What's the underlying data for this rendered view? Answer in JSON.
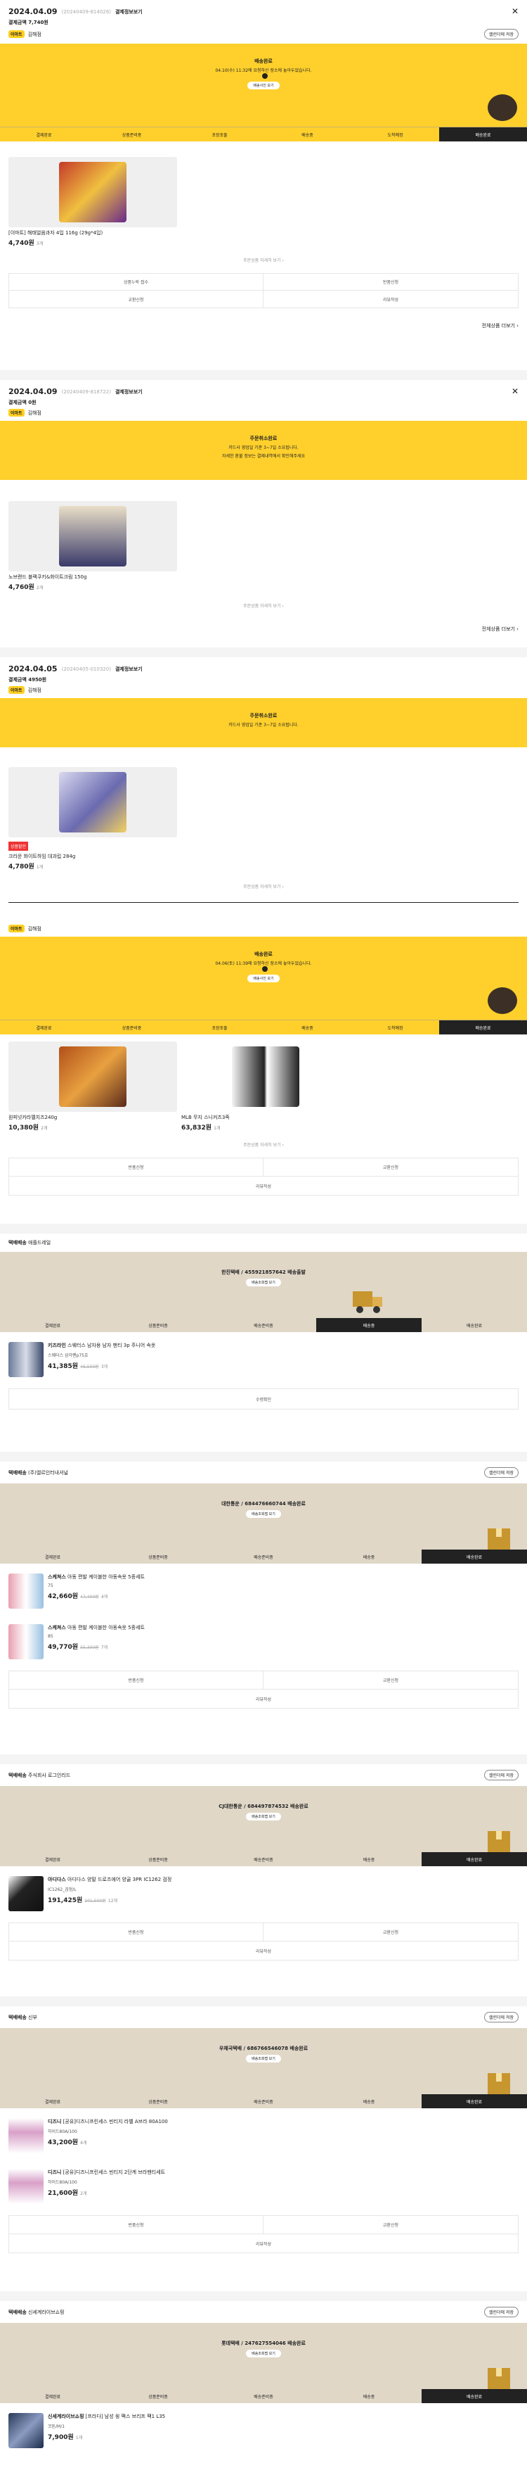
{
  "orders": [
    {
      "date": "2024.04.09",
      "order_no": "(20240409-814028)",
      "detail": "결제정보보기",
      "summary": "결제금액 7,740원",
      "shop": "김해점",
      "banner": {
        "title": "배송완료",
        "sub": "04.10(수) 11:32에 요청하신 장소에 놓아두었습니다.",
        "btn": "배송사진 보기"
      },
      "tabs": [
        "결제완료",
        "상품준비중",
        "포장포출",
        "배송중",
        "도착예정",
        "배송완료"
      ],
      "items": [
        {
          "name": "[이마트] 해태얼음과자 4입 116g (29g*4입)",
          "price": "4,740원",
          "qty": "3개"
        }
      ],
      "hint": "주문상품 자세히 보기 ›",
      "actions": [
        "상품누락 접수",
        "반품신청",
        "교환신청",
        "리뷰작성"
      ],
      "more": "전체상품 더보기 ›"
    },
    {
      "date": "2024.04.09",
      "order_no": "(20240409-818722)",
      "detail": "결제정보보기",
      "summary": "결제금액 0원",
      "shop": "김해점",
      "banner": {
        "title": "주문취소완료",
        "sub": "카드사 영업일 기준 3~7일 소요됩니다.",
        "sub2": "자세한 환불 정보는 결제내역에서 확인해주세요"
      },
      "items": [
        {
          "name": "노브랜드 블랙쿠키&화이트크림 150g",
          "price": "4,760원",
          "qty": "2개"
        }
      ],
      "hint": "주문상품 자세히 보기 ›",
      "more": "전체상품 더보기 ›"
    },
    {
      "date": "2024.04.05",
      "order_no": "(20240405-010320)",
      "detail": "결제정보보기",
      "summary": "결제금액 4950원",
      "shop": "김해점",
      "banner": {
        "title": "주문취소완료",
        "sub": "카드사 영업일 기준 3~7일 소요됩니다."
      },
      "items": [
        {
          "sale": "상품할인",
          "name": "크라운 화이트하임 대과립 284g",
          "price": "4,780원",
          "qty": "1개"
        }
      ],
      "hint": "주문상품 자세히 보기 ›"
    },
    {
      "shop": "김해점",
      "banner": {
        "title": "배송완료",
        "sub": "04.06(토) 11:39에 요청하신 장소에 놓아두었습니다.",
        "btn": "배송사진 보기"
      },
      "tabs": [
        "결제완료",
        "상품준비중",
        "포장포출",
        "배송중",
        "도착예정",
        "배송완료"
      ],
      "items": [
        {
          "name": "원피넛카라멜치즈240g",
          "price": "10,380원",
          "qty": "2개"
        },
        {
          "name": "MLB 무지 스니커즈3족",
          "price": "63,832원",
          "qty": "1개"
        }
      ],
      "hint": "주문상품 자세히 보기 ›",
      "actions": [
        "반품신청",
        "교환신청",
        "리뷰작성"
      ]
    }
  ],
  "shipments": [
    {
      "label": "택배배송",
      "vendor": "애플드레일",
      "banner": "한진택배 / 455921857642 배송출발",
      "btn": "배송조회맵 보기",
      "tabs": [
        "결제완료",
        "상품준비중",
        "배송준비중",
        "배송중",
        "배송완료"
      ],
      "active": 3,
      "items": [
        {
          "brand": "키즈라인",
          "name": "스웨터스 남자용 남자 팬티 3p 주니어 속옷",
          "opt": "스웨터스 삼각팬p75호",
          "price": "41,385원",
          "orig": "46,500원",
          "qty": "3개"
        }
      ],
      "actions": [
        "수령확인"
      ]
    },
    {
      "label": "택배배송",
      "vendor": "(주)엘르인터내셔널",
      "cal": true,
      "banner": "대한통운 / 684476660744 배송완료",
      "btn": "배송조회맵 보기",
      "tabs": [
        "결제완료",
        "상품준비중",
        "배송준비중",
        "배송중",
        "배송완료"
      ],
      "active": 4,
      "items": [
        {
          "brand": "스케쳐스",
          "name": "아동 편발 케이블한 아동속옷 5종세트",
          "opt": "75",
          "price": "42,660원",
          "orig": "47,400원",
          "qty": "4개"
        },
        {
          "brand": "스케쳐스",
          "name": "아동 편발 케이블한 아동속옷 5종세트",
          "opt": "85",
          "price": "49,770원",
          "orig": "55,300원",
          "qty": "7개"
        }
      ],
      "actions": [
        "반품신청",
        "교환신청",
        "리뷰작성"
      ]
    },
    {
      "label": "택배배송",
      "vendor": "주식회사 로그인리드",
      "cal": true,
      "banner": "CJ대한통운 / 684497874532 배송완료",
      "btn": "배송조회맵 보기",
      "tabs": [
        "결제완료",
        "상품준비중",
        "배송준비중",
        "배송중",
        "배송완료"
      ],
      "active": 4,
      "items": [
        {
          "brand": "아디다스",
          "name": "아디다스 양말 드로즈에어 양골 3PR IC1262 검정",
          "opt": "IC1262_검정/L",
          "price": "191,425원",
          "orig": "201,500원",
          "qty": "12개"
        }
      ],
      "actions": [
        "반품신청",
        "교환신청",
        "리뷰작성"
      ]
    },
    {
      "label": "택배배송",
      "vendor": "신부",
      "cal": true,
      "banner": "우체국택배 / 686766546078 배송완료",
      "btn": "배송조회맵 보기",
      "tabs": [
        "결제완료",
        "상품준비중",
        "배송준비중",
        "배송중",
        "배송완료"
      ],
      "active": 4,
      "items": [
        {
          "brand": "디즈니",
          "name": "[공유]디즈니프린세스 빈티지 라벨 A브라 80A100",
          "opt": "하이드80A/100",
          "price": "43,200원",
          "qty": "4개"
        },
        {
          "brand": "디즈니",
          "name": "[공유]디즈니프린세스 빈티지 2단계 브라팬티세트",
          "opt": "하이드80A/100",
          "price": "21,600원",
          "qty": "2개"
        }
      ],
      "actions": [
        "반품신청",
        "교환신청",
        "리뷰작성"
      ]
    },
    {
      "label": "택배배송",
      "vendor": "신세계라이브쇼핑",
      "cal": true,
      "banner": "롯데택배 / 247627554046 배송완료",
      "btn": "배송조회맵 보기",
      "tabs": [
        "결제완료",
        "상품준비중",
        "배송준비중",
        "배송중",
        "배송완료"
      ],
      "active": 4,
      "items": [
        {
          "brand": "신세계라이브쇼핑",
          "name": "[프라다] 남성 윙 팩스 브리프 팩1 L35",
          "opt": "코튼/M/1",
          "price": "7,900원",
          "qty": "1개"
        }
      ],
      "actions": []
    }
  ],
  "calendar_label": "캘린더에 저장",
  "colors": {
    "accent": "#ffd02c",
    "taupe": "#e0d7c7",
    "active_tab": "#222222"
  }
}
